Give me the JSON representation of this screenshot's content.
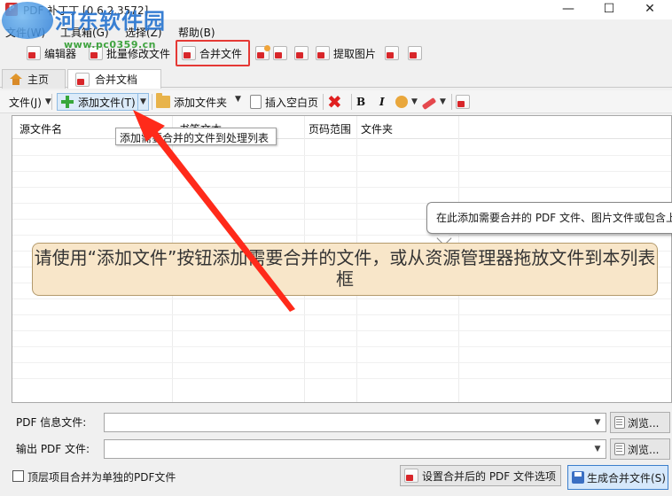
{
  "window": {
    "title": "PDF 补丁丁 [0.6.2.3572]",
    "controls": [
      "—",
      "☐",
      "✕"
    ]
  },
  "watermark": {
    "name": "河东软件园",
    "url": "www.pc0359.cn"
  },
  "menu": [
    "文件(W)",
    "工具箱(G)",
    "选择(Z)",
    "帮助(B)"
  ],
  "toolbar": {
    "editor": "编辑器",
    "batch_edit": "批量修改文件",
    "merge": "合并文件",
    "extract_images": "提取图片"
  },
  "tabs": [
    "主页",
    "合并文档"
  ],
  "subtoolbar": {
    "file_menu": "文件(J)",
    "add_file": "添加文件(T)",
    "add_folder": "添加文件夹",
    "insert_blank": "插入空白页",
    "bold": "B",
    "italic": "I"
  },
  "tooltip": "添加需要合并的文件到处理列表",
  "columns": [
    "源文件名",
    "书签文本",
    "页码范围",
    "文件夹"
  ],
  "help_bubble": "在此添加需要合并的 PDF 文件、图片文件或包含上",
  "drop_hint": "请使用“添加文件”按钮添加需要合并的文件，或从资源管理器拖放文件到本列表框",
  "form": {
    "info_label": "PDF 信息文件:",
    "output_label": "输出 PDF 文件:",
    "info_value": "",
    "output_value": "",
    "browse": "浏览...",
    "toplevel_checkbox": "顶层项目合并为单独的PDF文件",
    "toplevel_checked": false,
    "settings_button": "设置合并后的 PDF 文件选项",
    "generate_button": "生成合并文件(S)"
  },
  "colors": {
    "highlight_border": "#e53935",
    "arrow": "#ff2a1a",
    "hint_background": "#f8e6c9",
    "pdf_red": "#d8262a"
  }
}
